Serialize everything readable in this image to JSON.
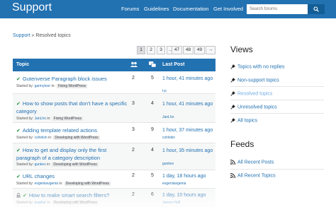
{
  "header": {
    "logo": "Support",
    "nav": [
      "Forums",
      "Guidelines",
      "Documentation",
      "Get Involved"
    ],
    "search_placeholder": "Search forums"
  },
  "breadcrumb": {
    "home": "Support",
    "sep": " » ",
    "current": "Resolved topics"
  },
  "pagination": [
    "1",
    "2",
    "3",
    "…",
    "47",
    "48",
    "49",
    "→"
  ],
  "table": {
    "headers": {
      "topic": "Topic",
      "last_post": "Last Post"
    },
    "rows": [
      {
        "title": "Gutenverse Paragraph block issues",
        "started_prefix": "Started by:",
        "author": "garmytoor",
        "in": "in:",
        "forum": "Fixing WordPress",
        "voices": "2",
        "posts": "5",
        "last": "1 hour, 41 minutes ago",
        "last_by": "t-p"
      },
      {
        "title": "How to show posts that don't have a specific category",
        "started_prefix": "Started by:",
        "author": "JanLho",
        "in": "in:",
        "forum": "Fixing WordPress",
        "voices": "3",
        "posts": "4",
        "last": "1 hour, 41 minutes ago",
        "last_by": "JanLho"
      },
      {
        "title": "Adding template related actions",
        "started_prefix": "Started by:",
        "author": "cshinkin",
        "in": "in:",
        "forum": "Developing with WordPress",
        "voices": "3",
        "posts": "9",
        "last": "1 hour, 37 minutes ago",
        "last_by": "cshinkin"
      },
      {
        "title": "How to get and display only the first paragraph of a category description",
        "started_prefix": "Started by:",
        "author": "gunkev",
        "in": "in:",
        "forum": "Developing with WordPress",
        "voices": "2",
        "posts": "4",
        "last": "1 hour, 35 minutes ago",
        "last_by": "gunkev"
      },
      {
        "title": "URL changes",
        "started_prefix": "Started by:",
        "author": "evgeniiavgenia",
        "in": "in:",
        "forum": "Developing with WordPress",
        "voices": "2",
        "posts": "5",
        "last": "1 day, 18 hours ago",
        "last_by": "evgeniiavgenia"
      },
      {
        "title": "How to make smart search filters?",
        "started_prefix": "Started by:",
        "author": "jsaghar",
        "in": "in:",
        "forum": "Developing with WordPress",
        "voices": "2",
        "posts": "6",
        "last": "1 day, 10 hours ago",
        "last_by": "James Huff"
      }
    ]
  },
  "sidebar": {
    "views_title": "Views",
    "views": [
      "Topics with no replies",
      "Non-support topics",
      "Resolved topics",
      "Unresolved topics",
      "All topics"
    ],
    "feeds_title": "Feeds",
    "feeds": [
      "All Recent Posts",
      "All Recent Topics"
    ]
  }
}
